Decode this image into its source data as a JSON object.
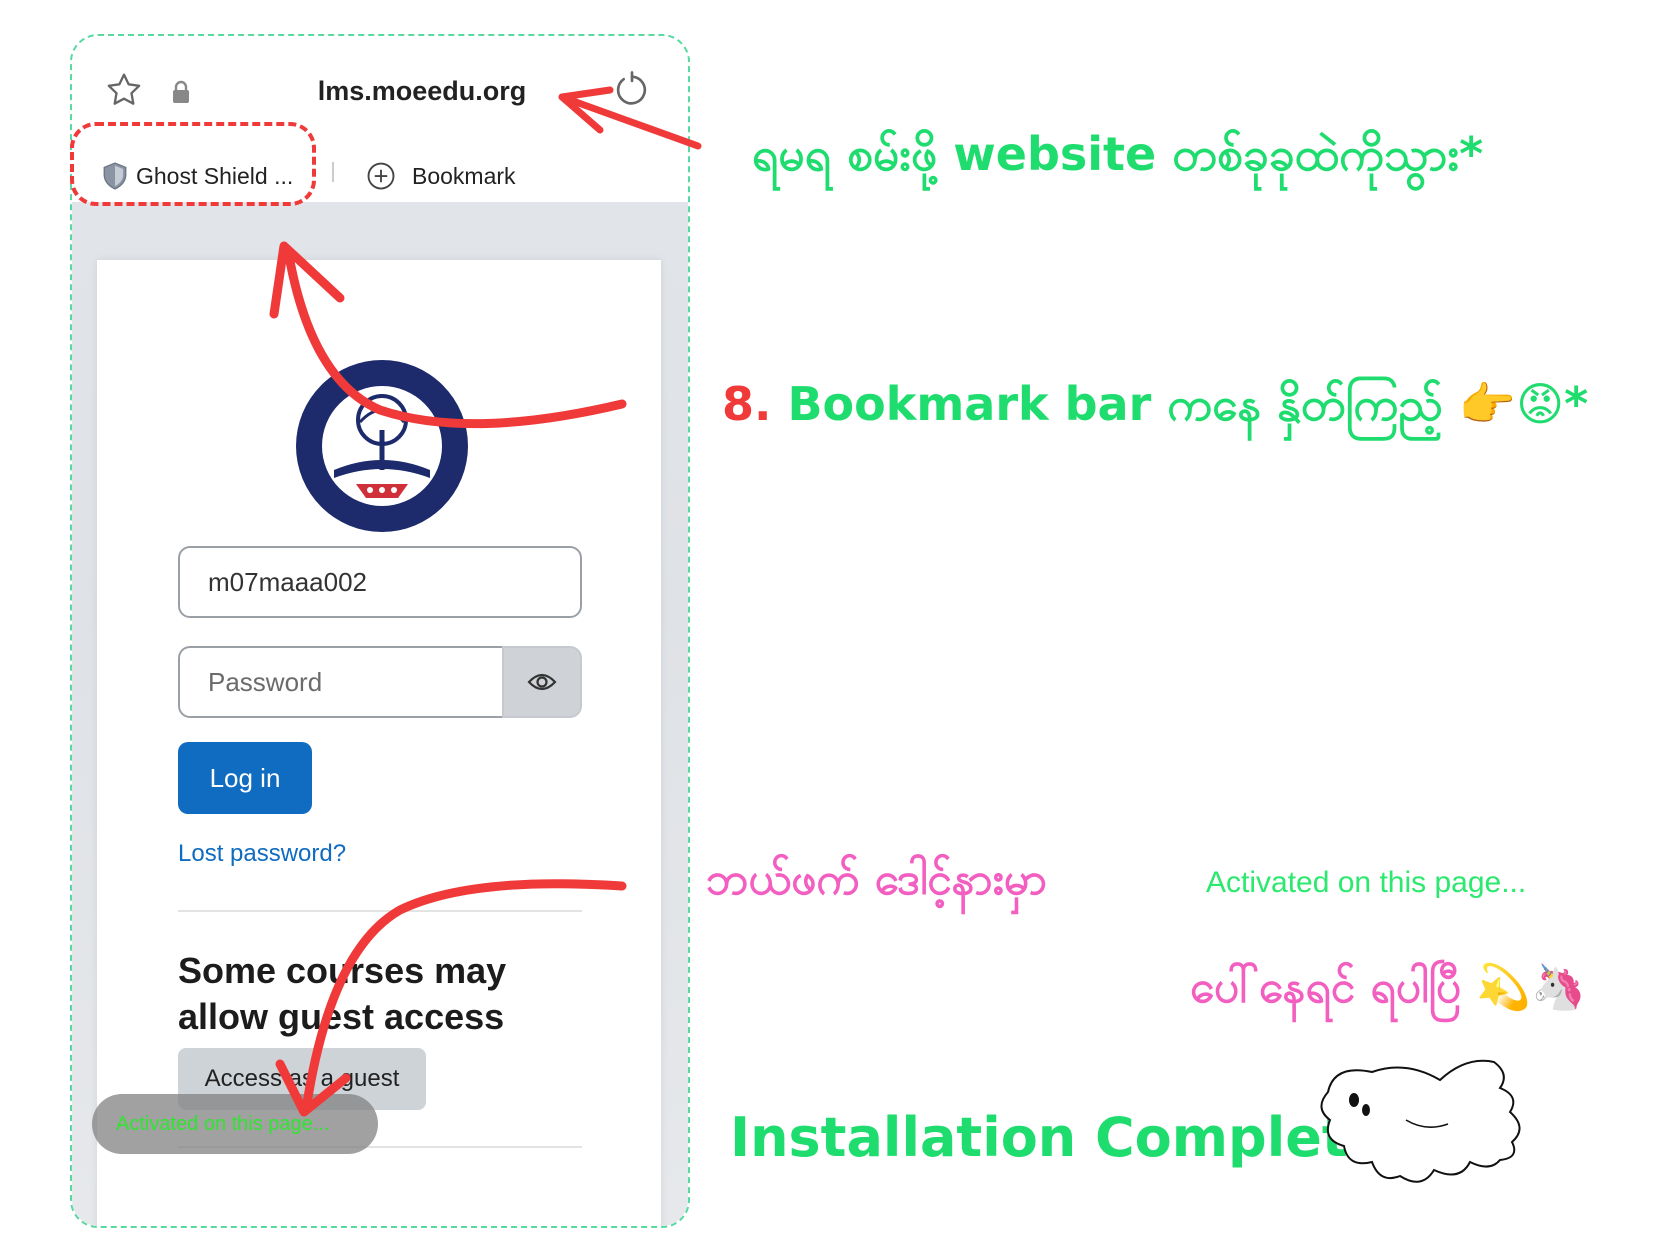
{
  "browser": {
    "url": "lms.moeedu.org",
    "bookmarks": [
      {
        "label": "Ghost Shield ..."
      },
      {
        "label": "Bookmark"
      }
    ]
  },
  "login": {
    "username_value": "m07maaa002",
    "password_placeholder": "Password",
    "login_label": "Log in",
    "lost_password": "Lost password?",
    "guest_title": "Some courses may allow guest access",
    "guest_button": "Access as a guest"
  },
  "toast": {
    "text": "Activated on this page..."
  },
  "annotations": {
    "caption_1": "ရမရ စမ်းဖို့ website တစ်ခုခုထဲကိုသွား*",
    "caption_2_number": "8.",
    "caption_2_text": "Bookmark bar ကနေ နှိတ်ကြည့် 👉😡*",
    "caption_3": "ဘယ်ဖက် ဒေါင့်နားမှာ",
    "caption_3_small": "Activated on this page...",
    "caption_4": "ပေါ်နေရင် ရပါပြီ 💫🦄",
    "complete_text": "Installation Complete",
    "complete_mark": "*"
  },
  "colors": {
    "annotation_green": "#1fdc6e",
    "annotation_red": "#f03a3a",
    "annotation_pink": "#f25fc0",
    "login_blue": "#0f6cc0",
    "frame_border": "#57d9a0"
  },
  "icons": [
    "star-icon",
    "lock-icon",
    "reload-icon",
    "shield-icon",
    "plus-circle-icon",
    "eye-icon",
    "ghost-icon"
  ]
}
